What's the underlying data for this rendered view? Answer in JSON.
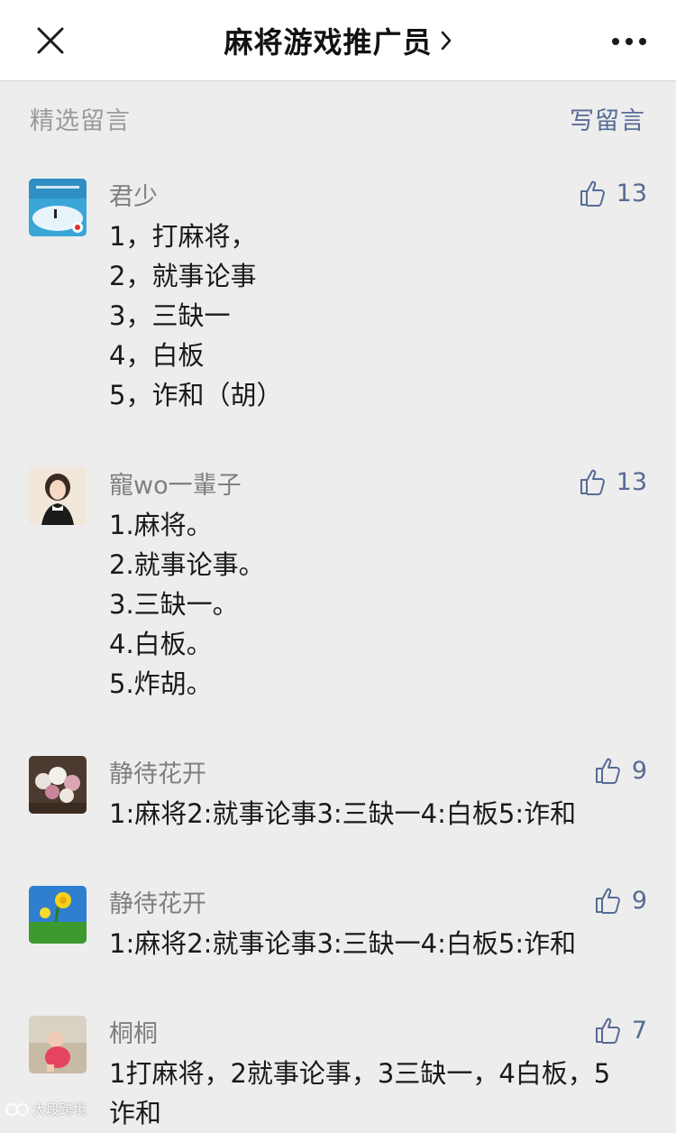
{
  "header": {
    "title": "麻将游戏推广员",
    "close_icon": "close-icon",
    "chevron_icon": "chevron-right-icon",
    "more_icon": "more-icon"
  },
  "section": {
    "label": "精选留言",
    "write_label": "写留言"
  },
  "colors": {
    "link": "#576b95",
    "background": "#ededed",
    "muted": "#9a9a9a"
  },
  "comments": [
    {
      "nickname": "君少",
      "likes": "13",
      "lines": [
        "1，打麻将，",
        "2，就事论事",
        "3，三缺一",
        "4，白板",
        "5，诈和（胡）"
      ]
    },
    {
      "nickname": "寵wo一輩子",
      "likes": "13",
      "lines": [
        "1.麻将。",
        "2.就事论事。",
        "3.三缺一。",
        "4.白板。",
        "5.炸胡。"
      ]
    },
    {
      "nickname": "静待花开",
      "likes": "9",
      "lines": [
        "1:麻将2:就事论事3:三缺一4:白板5:诈和"
      ]
    },
    {
      "nickname": "静待花开",
      "likes": "9",
      "lines": [
        "1:麻将2:就事论事3:三缺一4:白板5:诈和"
      ]
    },
    {
      "nickname": "桐桐",
      "likes": "7",
      "lines": [
        "1打麻将，2就事论事，3三缺一，4白板，5诈和"
      ]
    }
  ],
  "watermark": {
    "text": "大段跨境"
  }
}
